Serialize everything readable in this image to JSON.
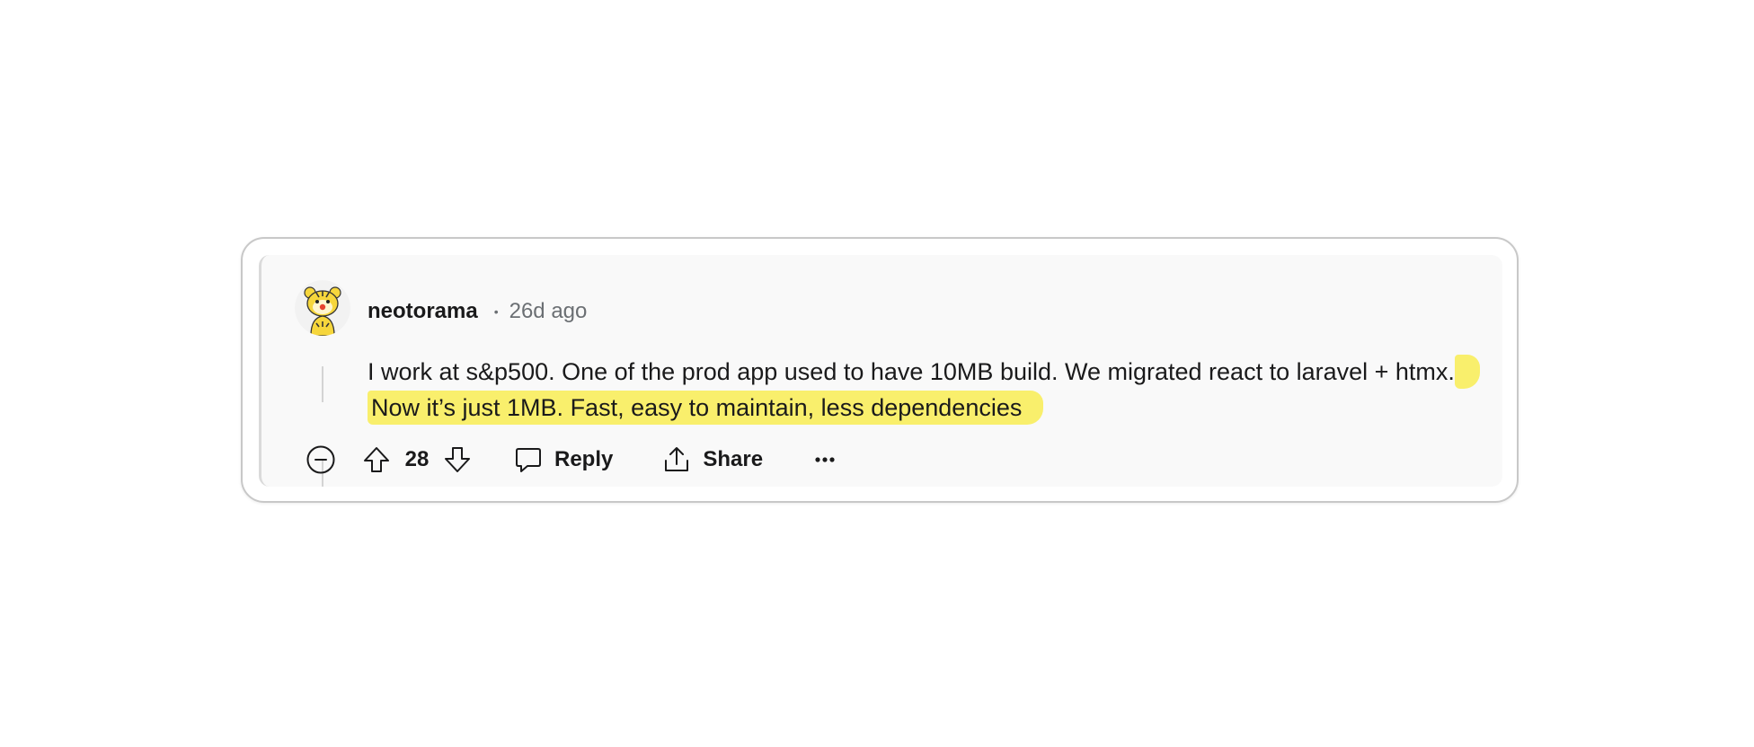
{
  "comment": {
    "username": "neotorama",
    "separator": "•",
    "timestamp": "26d ago",
    "body_plain": "I work at s&p500. One of the prod app used to have 10MB build. We migrated react to laravel + htmx.",
    "body_highlighted": " Now it’s just 1MB. Fast, easy to maintain, less dependencies",
    "highlight_color": "#f9ef6c"
  },
  "actions": {
    "score": "28",
    "reply_label": "Reply",
    "share_label": "Share"
  },
  "icons": {
    "collapse": "collapse-minus-icon",
    "upvote": "upvote-arrow-icon",
    "downvote": "downvote-arrow-icon",
    "reply": "speech-bubble-icon",
    "share": "share-upload-icon",
    "more": "ellipsis-icon",
    "avatar": "tiger-snoo-avatar"
  }
}
